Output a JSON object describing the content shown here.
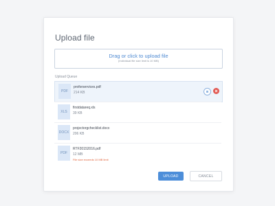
{
  "dialog": {
    "title": "Upload file",
    "dropzone": {
      "main": "Drag or click to upload file",
      "sub": "(Individual file size limit is 10 MB)"
    },
    "queue_label": "Upload Queue",
    "files": [
      {
        "type": "PDF",
        "name": "proforservices.pdf",
        "size": "214 KB",
        "error": ""
      },
      {
        "type": "XLS",
        "name": "firstdatareq.xls",
        "size": "39 KB",
        "error": ""
      },
      {
        "type": "DOCX",
        "name": "projectorgchecklist.docx",
        "size": "206 KB",
        "error": ""
      },
      {
        "type": "PDF",
        "name": "RTF20152016.pdf",
        "size": "12 MB",
        "error": "File size exceeds 10 MB limit"
      }
    ],
    "buttons": {
      "upload": "UPLOAD",
      "cancel": "CANCEL"
    }
  },
  "colors": {
    "accent": "#4d8ed9",
    "error": "#e0623a",
    "delete": "#e25a53"
  }
}
